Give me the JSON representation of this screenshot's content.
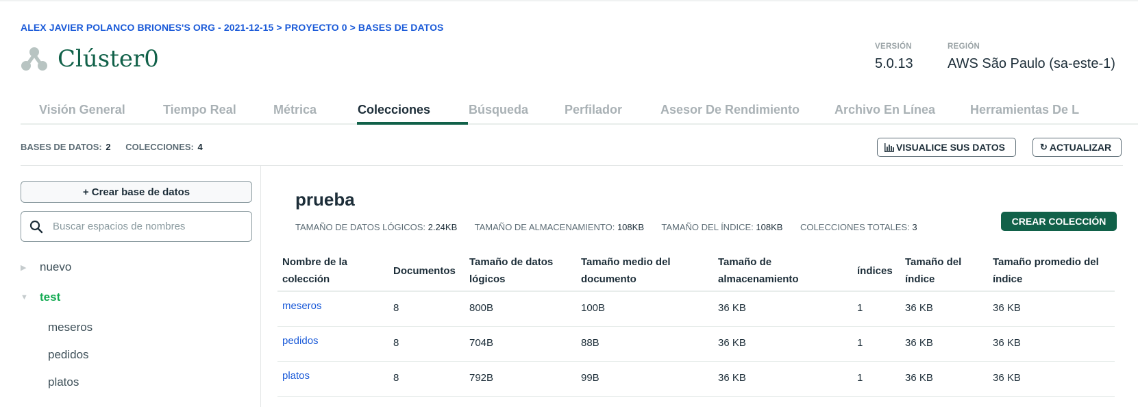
{
  "breadcrumb": "ALEX JAVIER POLANCO BRIONES'S ORG - 2021-12-15 > PROYECTO 0 > BASES DE DATOS",
  "cluster": {
    "name": "Clúster0",
    "icon": "cluster-icon"
  },
  "version": {
    "label": "VERSIÓN",
    "value": "5.0.13"
  },
  "region": {
    "label": "REGIÓN",
    "value": "AWS São Paulo (sa-este-1)"
  },
  "tabs": [
    {
      "label": "Visión General"
    },
    {
      "label": "Tiempo Real"
    },
    {
      "label": "Métrica"
    },
    {
      "label": "Colecciones",
      "active": true
    },
    {
      "label": "Búsqueda"
    },
    {
      "label": "Perfilador"
    },
    {
      "label": "Asesor De Rendimiento"
    },
    {
      "label": "Archivo En Línea"
    },
    {
      "label": "Herramientas De L"
    }
  ],
  "counts": {
    "databases_label": "BASES DE DATOS:",
    "databases_value": "2",
    "collections_label": "COLECCIONES:",
    "collections_value": "4"
  },
  "actions": {
    "visualize_label": "VISUALICE SUS DATOS",
    "refresh_label": "ACTUALIZAR"
  },
  "sidebar": {
    "create_db_label": "+ Crear base de datos",
    "search_placeholder": "Buscar espacios de nombres",
    "databases": [
      {
        "name": "nuevo",
        "expanded": false
      },
      {
        "name": "test",
        "expanded": true,
        "collections": [
          "meseros",
          "pedidos",
          "platos"
        ]
      }
    ]
  },
  "main": {
    "db_name": "prueba",
    "stats": [
      {
        "label": "TAMAÑO DE DATOS LÓGICOS:",
        "value": "2.24KB"
      },
      {
        "label": "TAMAÑO DE ALMACENAMIENTO:",
        "value": "108KB"
      },
      {
        "label": "TAMAÑO DEL ÍNDICE:",
        "value": "108KB"
      },
      {
        "label": "COLECCIONES TOTALES:",
        "value": "3"
      }
    ],
    "create_collection_label": "CREAR COLECCIÓN",
    "table": {
      "headers": [
        "Nombre de la colección",
        "Documentos",
        "Tamaño de datos lógicos",
        "Tamaño medio del documento",
        "Tamaño de almacenamiento",
        "índices",
        "Tamaño del índice",
        "Tamaño promedio del índice"
      ],
      "header_lines": [
        [
          "Nombre de la",
          "colección"
        ],
        [
          "Documentos"
        ],
        [
          "Tamaño de datos",
          "lógicos"
        ],
        [
          "Tamaño medio del",
          "documento"
        ],
        [
          "Tamaño de",
          "almacenamiento"
        ],
        [
          "índices"
        ],
        [
          "Tamaño del",
          "índice"
        ],
        [
          "Tamaño promedio del",
          "índice"
        ]
      ],
      "rows": [
        [
          "meseros",
          "8",
          "800B",
          "100B",
          "36 KB",
          "1",
          "36 KB",
          "36 KB"
        ],
        [
          "pedidos",
          "8",
          "704B",
          "88B",
          "36 KB",
          "1",
          "36 KB",
          "36 KB"
        ],
        [
          "platos",
          "8",
          "792B",
          "99B",
          "36 KB",
          "1",
          "36 KB",
          "36 KB"
        ]
      ]
    }
  },
  "colors": {
    "accent": "#116149",
    "link": "#1a5ad8",
    "active_db": "#13aa52"
  }
}
